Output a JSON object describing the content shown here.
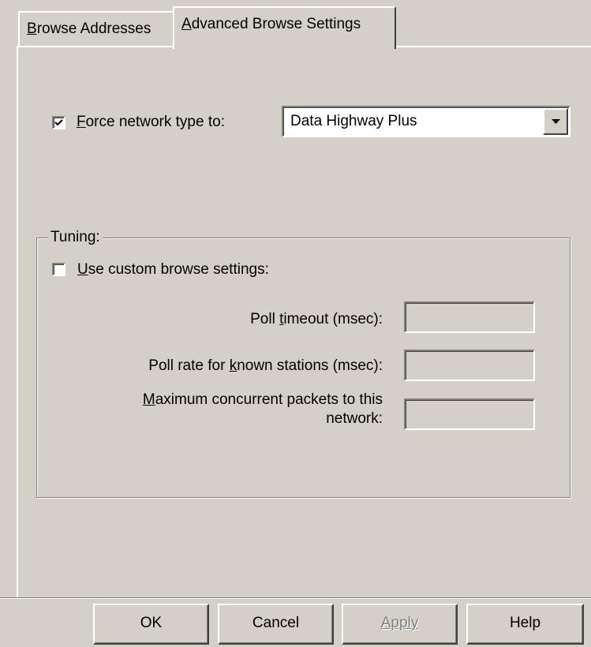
{
  "tabs": [
    {
      "label_pre": "",
      "label_key": "B",
      "label_post": "rowse Addresses",
      "active": false
    },
    {
      "label_pre": "",
      "label_key": "A",
      "label_post": "dvanced Browse Settings",
      "active": true
    }
  ],
  "force_network": {
    "checked": true,
    "label_pre": "",
    "label_key": "F",
    "label_post": "orce network type to:",
    "selected_value": "Data Highway Plus"
  },
  "tuning": {
    "title": "Tuning:",
    "custom_checked": false,
    "custom_label_pre": "",
    "custom_label_key": "U",
    "custom_label_post": "se custom browse settings:",
    "poll_timeout_pre": "Poll ",
    "poll_timeout_key": "t",
    "poll_timeout_post": "imeout (msec):",
    "poll_timeout_value": "",
    "poll_rate_pre": "Poll rate for ",
    "poll_rate_key": "k",
    "poll_rate_post": "nown stations (msec):",
    "poll_rate_value": "",
    "max_packets_line1_pre": "",
    "max_packets_line1_key": "M",
    "max_packets_line1_post": "aximum concurrent packets to this",
    "max_packets_line2": "network:",
    "max_packets_value": ""
  },
  "buttons": {
    "ok": "OK",
    "cancel": "Cancel",
    "apply": "Apply",
    "help": "Help"
  },
  "icons": {
    "checkmark": "check-icon",
    "dropdown": "down-arrow-icon"
  }
}
